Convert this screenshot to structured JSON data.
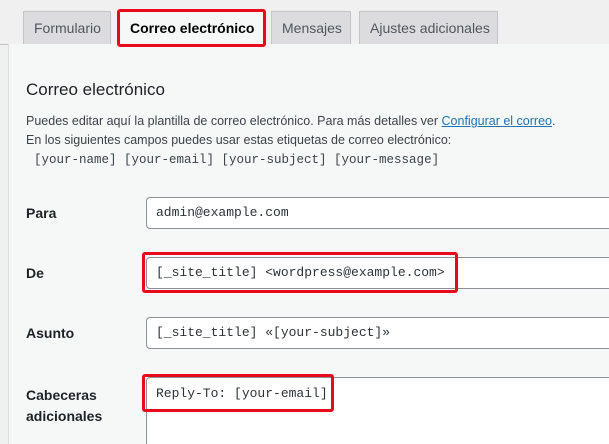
{
  "tabs": [
    {
      "label": "Formulario",
      "active": false
    },
    {
      "label": "Correo electrónico",
      "active": true
    },
    {
      "label": "Mensajes",
      "active": false
    },
    {
      "label": "Ajustes adicionales",
      "active": false
    }
  ],
  "section": {
    "title": "Correo electrónico",
    "description_line1_prefix": "Puedes editar aquí la plantilla de correo electrónico. Para más detalles ver ",
    "description_link": "Configurar el correo",
    "description_line1_suffix": ".",
    "description_line2": "En los siguientes campos puedes usar estas etiquetas de correo electrónico:",
    "tags": "[your-name] [your-email] [your-subject] [your-message]"
  },
  "fields": {
    "to": {
      "label": "Para",
      "value": "admin@example.com"
    },
    "from": {
      "label": "De",
      "value": "[_site_title] <wordpress@example.com>"
    },
    "subject": {
      "label": "Asunto",
      "value": "[_site_title] «[your-subject]»"
    },
    "headers": {
      "label_line1": "Cabeceras",
      "label_line2": "adicionales",
      "value": "Reply-To: [your-email]"
    }
  },
  "colors": {
    "highlight": "#e8091d",
    "link": "#2271b1",
    "panel_bg": "#f6f7f7",
    "page_bg": "#f0f0f1"
  }
}
